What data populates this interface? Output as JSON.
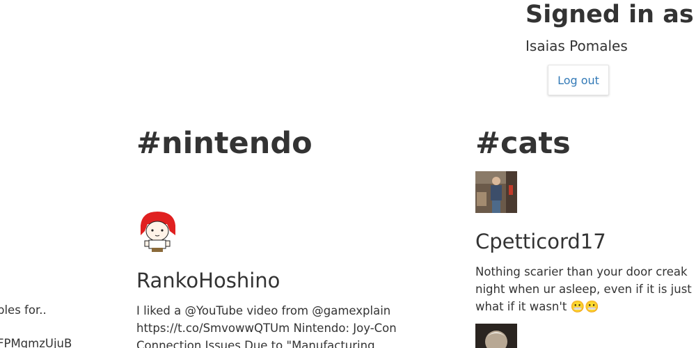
{
  "account": {
    "heading": "Signed in as:",
    "username": "Isaias Pomales",
    "logout_label": "Log out"
  },
  "columns": [
    {
      "hashtag": "",
      "tweets": [
        {
          "user": "",
          "text_lines": [
            "ples for..",
            "FPMgmzUjuB"
          ]
        }
      ]
    },
    {
      "hashtag": "#nintendo",
      "tweets": [
        {
          "user": "RankoHoshino",
          "text_lines": [
            "I liked a @YouTube video from @gamexplain",
            "https://t.co/SmvowwQTUm Nintendo: Joy-Con",
            "Connection Issues Due to \"Manufacturing"
          ]
        }
      ]
    },
    {
      "hashtag": "#cats",
      "tweets": [
        {
          "user": "Cpetticord17",
          "text_lines": [
            "Nothing scarier than your door creak",
            "night when ur asleep, even if it is just",
            "what if it wasn't 😬😬"
          ]
        }
      ]
    }
  ],
  "colors": {
    "text": "#333333",
    "link": "#337ab7",
    "background": "#ffffff"
  }
}
